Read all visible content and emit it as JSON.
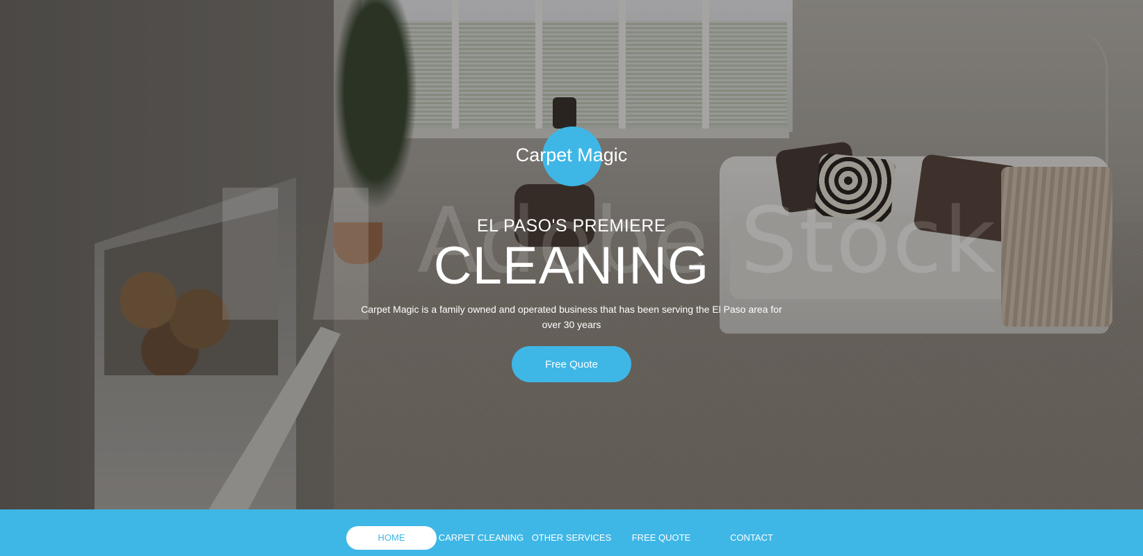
{
  "brand": {
    "name": "Carpet Magic",
    "accent_color": "#3eb7e6"
  },
  "hero": {
    "subtitle": "EL PASO'S PREMIERE",
    "headline": "CLEANING",
    "description": "Carpet Magic is a family owned and operated business that has been serving the El Paso area for over 30 years",
    "cta_label": "Free Quote",
    "watermark_text": "Adobe Stock"
  },
  "nav": {
    "items": [
      {
        "label": "HOME",
        "active": true
      },
      {
        "label": "CARPET CLEANING",
        "active": false
      },
      {
        "label": "OTHER SERVICES",
        "active": false
      },
      {
        "label": "FREE QUOTE",
        "active": false
      },
      {
        "label": "CONTACT",
        "active": false
      }
    ]
  }
}
